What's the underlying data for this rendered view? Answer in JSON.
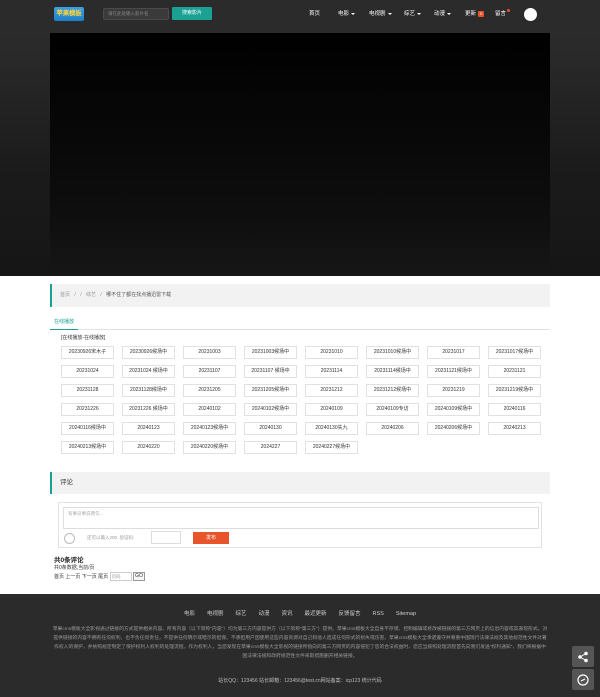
{
  "header": {
    "logo_text": "苹果模板",
    "search_placeholder": "请在此处输入影片名",
    "search_button": "搜索影片",
    "nav": [
      {
        "label": "首页",
        "dropdown": false
      },
      {
        "label": "电影",
        "dropdown": true
      },
      {
        "label": "电视剧",
        "dropdown": true
      },
      {
        "label": "综艺",
        "dropdown": true
      },
      {
        "label": "动漫",
        "dropdown": true
      },
      {
        "label": "更新",
        "dropdown": false,
        "badge": "0"
      },
      {
        "label": "留言",
        "dropdown": false,
        "dot": true
      }
    ]
  },
  "breadcrumb": {
    "items": [
      "首页",
      "/",
      "/",
      "综艺",
      "/"
    ],
    "current": "哪不住了都在找点播迅雷下载"
  },
  "episodes": {
    "tab": "在线播放",
    "source_label": "[在线播放-在线播放]",
    "list": [
      "20230926宋木子",
      "20230926候场中",
      "20231003",
      "20231003候场中",
      "20231010",
      "20231010候场中",
      "20231017",
      "20231017候场中",
      "20231024",
      "20231024 候场中",
      "20231107",
      "20231107 候场中",
      "20231114",
      "20231114候场中",
      "20231121候场中",
      "20231121",
      "20231128",
      "20231128候场中",
      "20231205",
      "20231205候场中",
      "20231212",
      "20231212候场中",
      "20231219",
      "20231219候场中",
      "20231226",
      "20231226 候场中",
      "20240102",
      "20240102候场中",
      "20240109",
      "20240109专访",
      "20240109候场中",
      "20240116",
      "20240116候场中",
      "20240123",
      "20240123候场中",
      "20240130",
      "20240130失九",
      "20240206",
      "20240206候场中",
      "20240213",
      "20240213候场中",
      "20240220",
      "20240220候场中",
      "2024227",
      "20240227候场中"
    ]
  },
  "comments": {
    "heading": "评论",
    "input_placeholder": "有事没事说两句...",
    "code_hint": "还可以输入200",
    "code_label": "验证码:",
    "publish_button": "发布",
    "count_text": "共0条评论",
    "sub_text": "共0条数据,当前/页",
    "pager_text": "首页 上一页 下一页 尾页",
    "page_placeholder": "页码",
    "go_button": "GO"
  },
  "footer": {
    "links": [
      "电影",
      "电视剧",
      "综艺",
      "动漫",
      "资讯",
      "最近更新",
      "反馈留言",
      "RSS",
      "Sitemap"
    ],
    "disclaimer": "苹果cms模板大全影视通过链接的方式提供相关内容。所有内容（以下简称\"内容\"）均为第三方内容提供方（以下简称\"第三方\"）提供。苹果cms模板大全自身不存储、控制编辑或修改被链接的第三方网页上的信息内容或其表现形式。对提供链接的内容不拥有任何权利，也不负任何责任，不提供任何明示或暗示的担保。不承担用户因使用这些内容资源对自己和他人造成任何形式的损失或伤害。苹果cms模板大全承诺遵守并尊重中国现行法律法规及其他规范性文件对著作权人的保护，并依照规定制定了保护权利人权利的处理流程。作为权利人，当您发现在苹果cms模板大全影视的链接所指向的第三方网页的内容侵犯了您的合法权益时，您应当按照处理流程首先向我们发送\"权利通知\"，我们将根据中国法律法规和政府规范性文件采取措施删开相关链接。",
    "contact": "站长QQ：123456 站长邮箱：123456@test.cn网站备案：icp123 统计代码"
  },
  "colors": {
    "accent": "#1aa194",
    "header_bg": "#2b2b2b",
    "publish": "#e8552d"
  }
}
